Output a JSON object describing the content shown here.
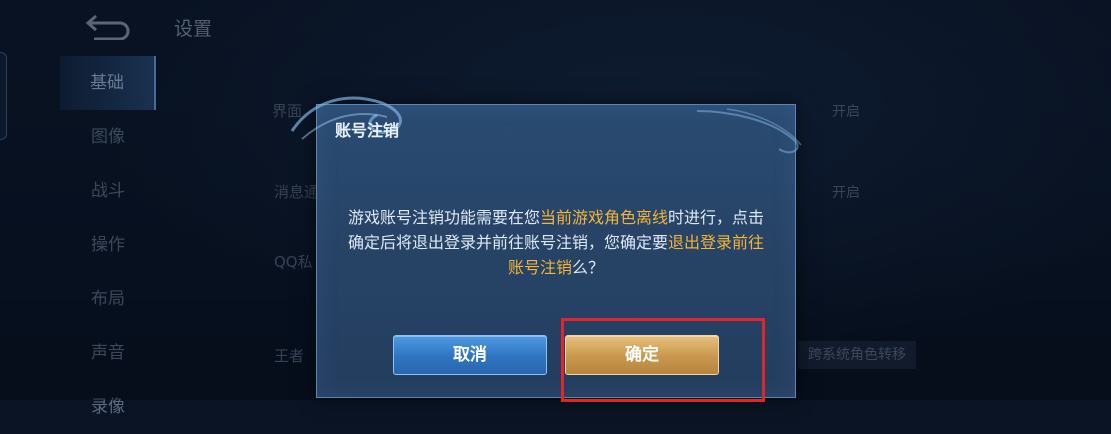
{
  "header": {
    "title": "设置"
  },
  "sidebar": {
    "items": [
      {
        "label": "基础"
      },
      {
        "label": "图像"
      },
      {
        "label": "战斗"
      },
      {
        "label": "操作"
      },
      {
        "label": "布局"
      },
      {
        "label": "声音"
      },
      {
        "label": "录像"
      }
    ],
    "active_index": 0
  },
  "background_rows": [
    {
      "label": "界面",
      "value": "开启"
    },
    {
      "label": "消息通",
      "value": "开启"
    },
    {
      "label": "QQ私"
    },
    {
      "label": "王者",
      "chip": "跨系统角色转移"
    }
  ],
  "dialog": {
    "title": "账号注销",
    "message": {
      "p1": "游戏账号注销功能需要在您",
      "hl1": "当前游戏角色离线",
      "p2": "时进行，点击确定后将退出登录并前往账号注销，您确定要",
      "hl2": "退出登录前往账号注销",
      "p3": "么？"
    },
    "cancel_label": "取消",
    "confirm_label": "确定"
  },
  "colors": {
    "highlight": "#f3b43a",
    "annotation": "#e0262b",
    "cancel_button": "#2f74c0",
    "confirm_button": "#c9974c"
  },
  "icons": {
    "back": "back-arrow-icon"
  }
}
